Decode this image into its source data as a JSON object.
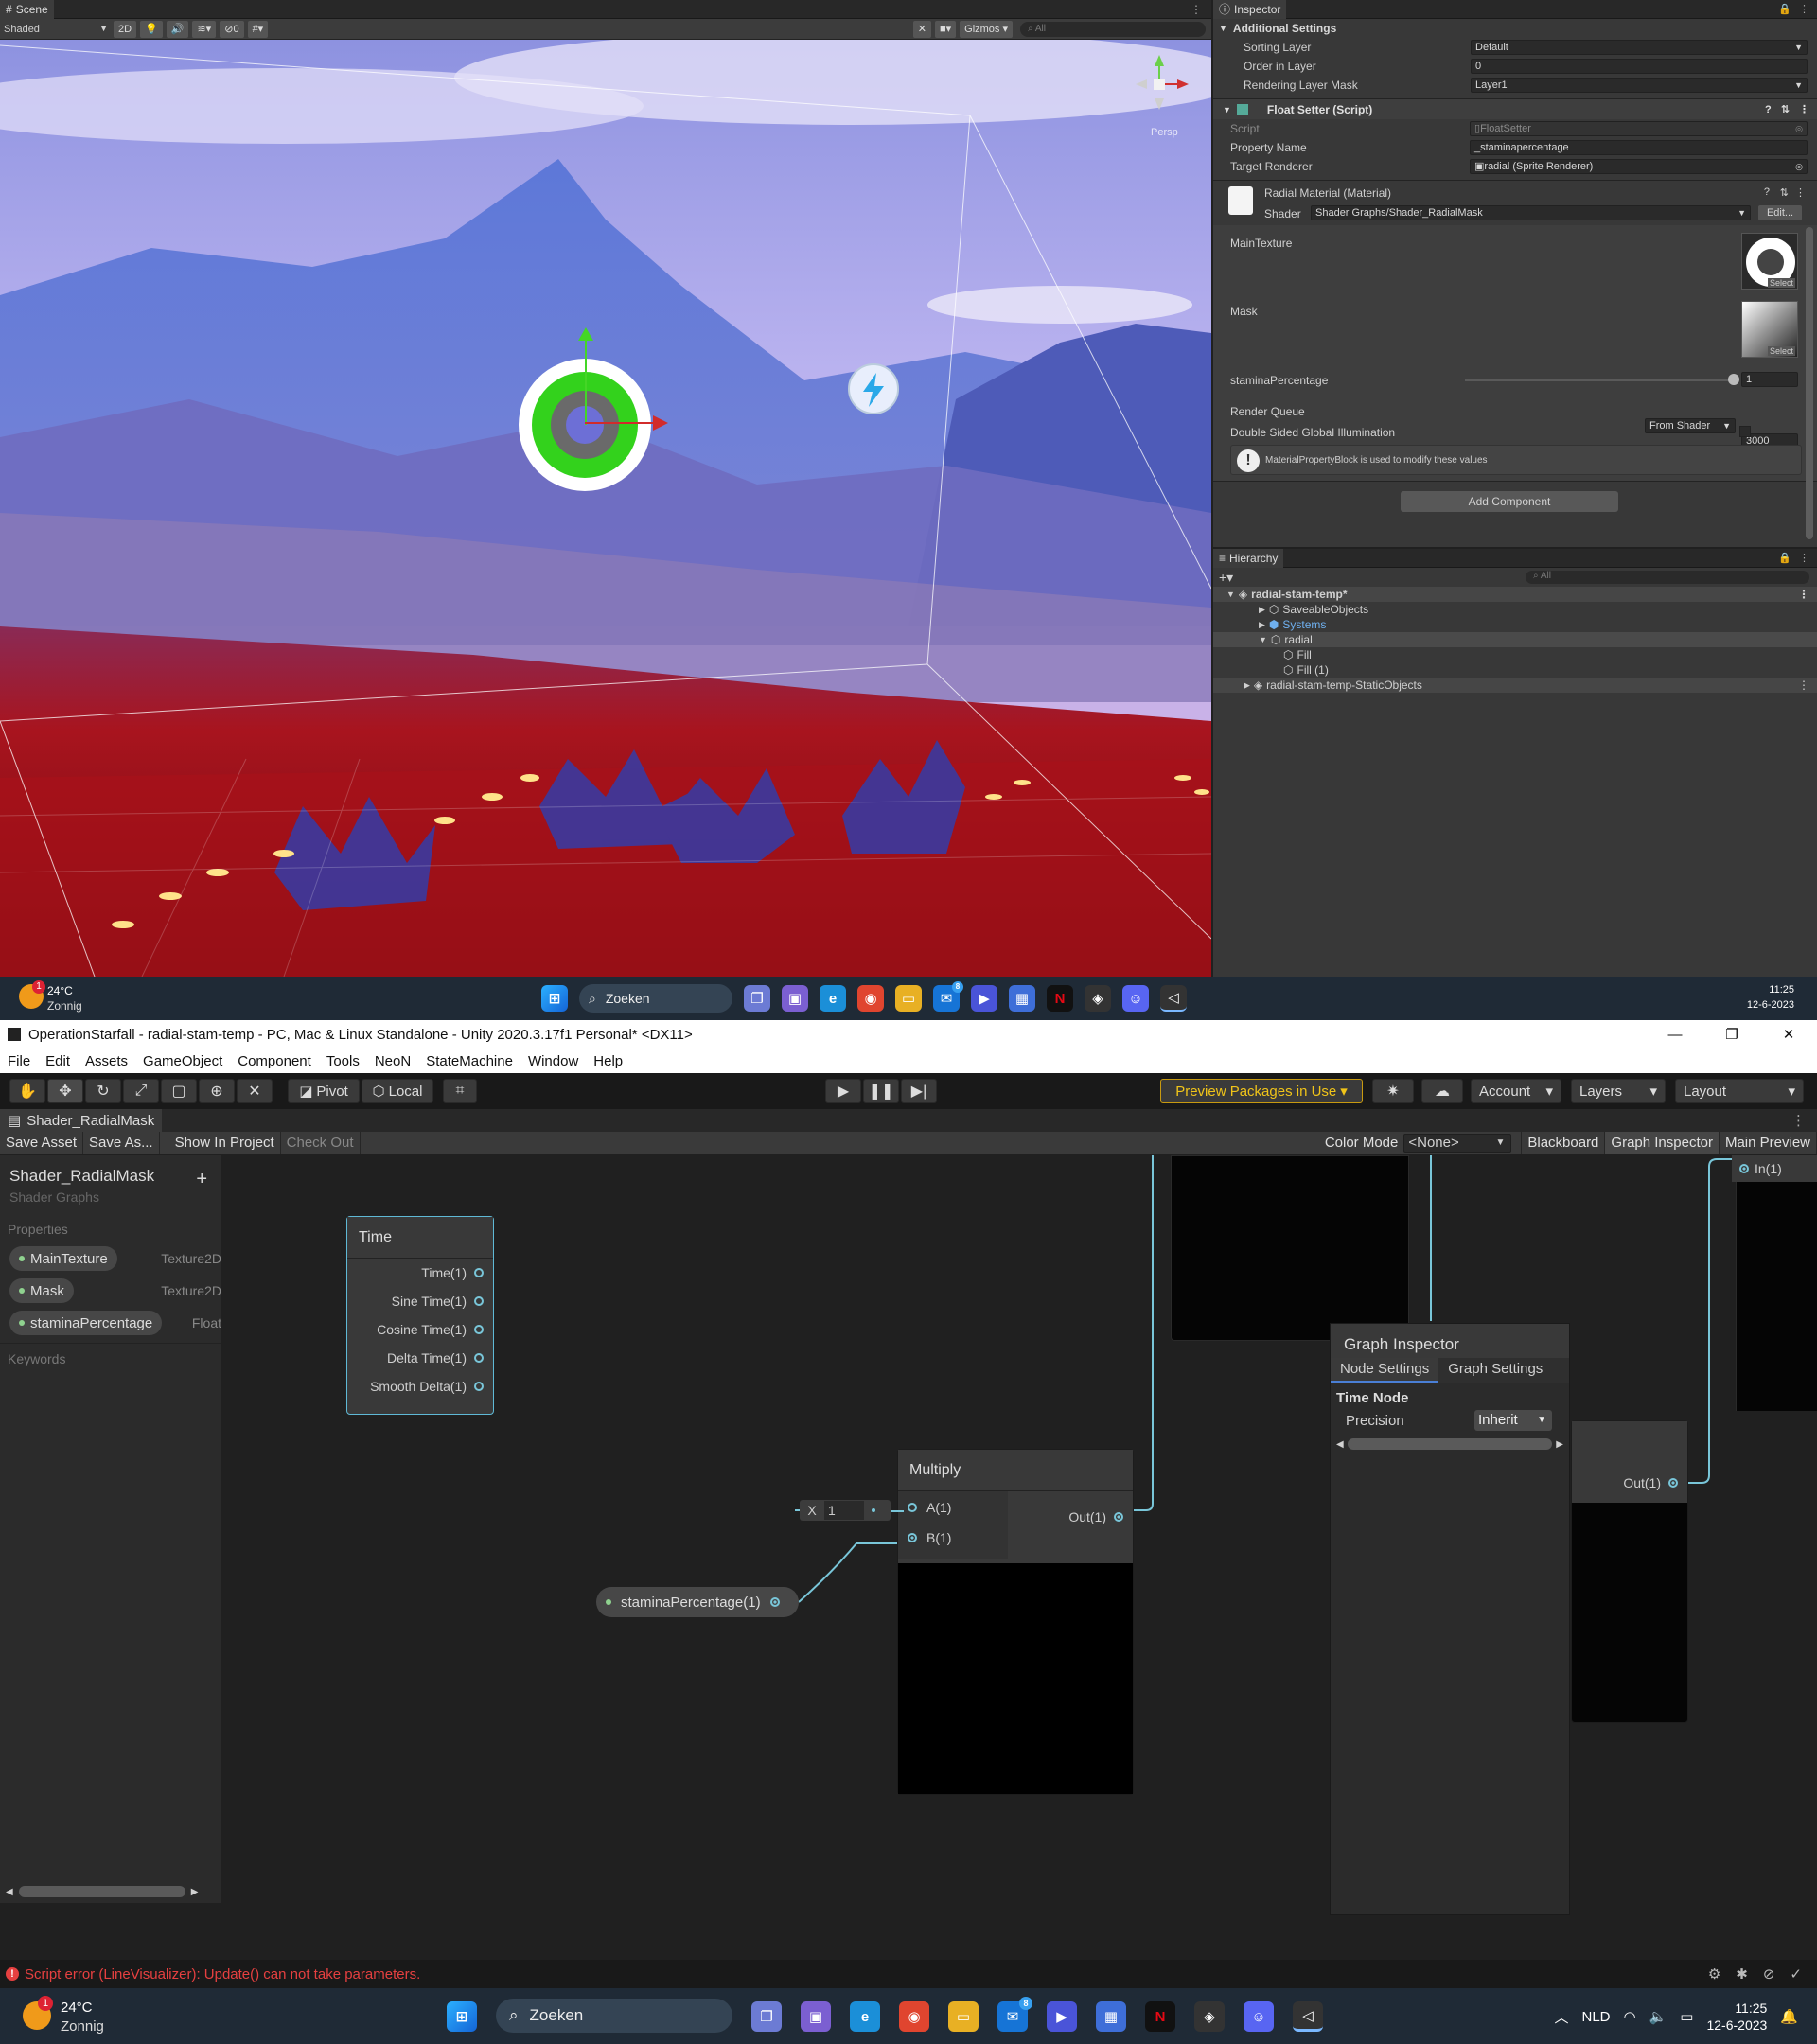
{
  "scene": {
    "tab_label": "Scene",
    "shading_mode": "Shaded",
    "mode_2d": "2D",
    "hidden_count": "0",
    "gizmos_label": "Gizmos",
    "search_placeholder": "All",
    "persp_label": "Persp"
  },
  "inspector": {
    "tab_label": "Inspector",
    "additional_settings": "Additional Settings",
    "sorting_layer_label": "Sorting Layer",
    "sorting_layer_value": "Default",
    "order_in_layer_label": "Order in Layer",
    "order_in_layer_value": "0",
    "rendering_layer_mask_label": "Rendering Layer Mask",
    "rendering_layer_mask_value": "Layer1",
    "float_setter_title": "Float Setter (Script)",
    "script_label": "Script",
    "script_value": "FloatSetter",
    "property_name_label": "Property Name",
    "property_name_value": "_staminapercentage",
    "target_renderer_label": "Target Renderer",
    "target_renderer_value": "radial (Sprite Renderer)",
    "material_title": "Radial Material (Material)",
    "shader_label": "Shader",
    "shader_value": "Shader Graphs/Shader_RadialMask",
    "edit_label": "Edit...",
    "main_texture_label": "MainTexture",
    "mask_label": "Mask",
    "select_label": "Select",
    "stamina_label": "staminaPercentage",
    "stamina_value": "1",
    "stamina_fraction": 1.0,
    "render_queue_label": "Render Queue",
    "render_queue_mode": "From Shader",
    "render_queue_value": "3000",
    "double_sided_gi_label": "Double Sided Global Illumination",
    "info_message": "MaterialPropertyBlock is used to modify these values",
    "add_component": "Add Component"
  },
  "hierarchy": {
    "tab_label": "Hierarchy",
    "search_placeholder": "All",
    "items": [
      {
        "label": "radial-stam-temp*"
      },
      {
        "label": "SaveableObjects"
      },
      {
        "label": "Systems"
      },
      {
        "label": "radial"
      },
      {
        "label": "Fill"
      },
      {
        "label": "Fill (1)"
      },
      {
        "label": "radial-stam-temp-StaticObjects"
      }
    ]
  },
  "taskbar_top": {
    "temperature": "24°C",
    "weather": "Zonnig",
    "search_label": "Zoeken",
    "time": "11:25",
    "date": "12-6-2023",
    "badge": "1",
    "mail_badge": "8"
  },
  "editor": {
    "window_title": "OperationStarfall - radial-stam-temp - PC, Mac & Linux Standalone - Unity 2020.3.17f1 Personal* <DX11>",
    "menu": [
      "File",
      "Edit",
      "Assets",
      "GameObject",
      "Component",
      "Tools",
      "NeoN",
      "StateMachine",
      "Window",
      "Help"
    ],
    "pivot_label": "Pivot",
    "local_label": "Local",
    "preview_packages": "Preview Packages in Use",
    "account_label": "Account",
    "layers_label": "Layers",
    "layout_label": "Layout",
    "accent_color": "#f0c419"
  },
  "shadergraph": {
    "tab_label": "Shader_RadialMask",
    "save_asset": "Save Asset",
    "save_as": "Save As...",
    "show_in_project": "Show In Project",
    "check_out": "Check Out",
    "color_mode_label": "Color Mode",
    "color_mode_value": "<None>",
    "blackboard_btn": "Blackboard",
    "graph_inspector_btn": "Graph Inspector",
    "main_preview_btn": "Main Preview",
    "blackboard": {
      "title": "Shader_RadialMask",
      "subtitle": "Shader Graphs",
      "properties_label": "Properties",
      "properties": [
        {
          "name": "MainTexture",
          "type": "Texture2D"
        },
        {
          "name": "Mask",
          "type": "Texture2D"
        },
        {
          "name": "staminaPercentage",
          "type": "Float"
        }
      ],
      "keywords_label": "Keywords"
    },
    "time_node": {
      "title": "Time",
      "outputs": [
        "Time(1)",
        "Sine Time(1)",
        "Cosine Time(1)",
        "Delta Time(1)",
        "Smooth Delta(1)"
      ]
    },
    "multiply_node": {
      "title": "Multiply",
      "input_a": "A(1)",
      "input_b": "B(1)",
      "output": "Out(1)",
      "x_label": "X",
      "x_value": "1"
    },
    "stamina_node": {
      "label": "staminaPercentage(1)"
    },
    "right_node_output": "Out(1)",
    "in_port": "In(1)",
    "graph_inspector": {
      "title": "Graph Inspector",
      "tab_node": "Node Settings",
      "tab_graph": "Graph Settings",
      "section": "Time Node",
      "precision_label": "Precision",
      "precision_value": "Inherit"
    },
    "error_message": "Script error (LineVisualizer): Update() can not take parameters."
  },
  "taskbar_bottom": {
    "temperature": "24°C",
    "weather": "Zonnig",
    "search_label": "Zoeken",
    "language": "NLD",
    "time": "11:25",
    "date": "12-6-2023",
    "badge": "1",
    "mail_badge": "8"
  }
}
